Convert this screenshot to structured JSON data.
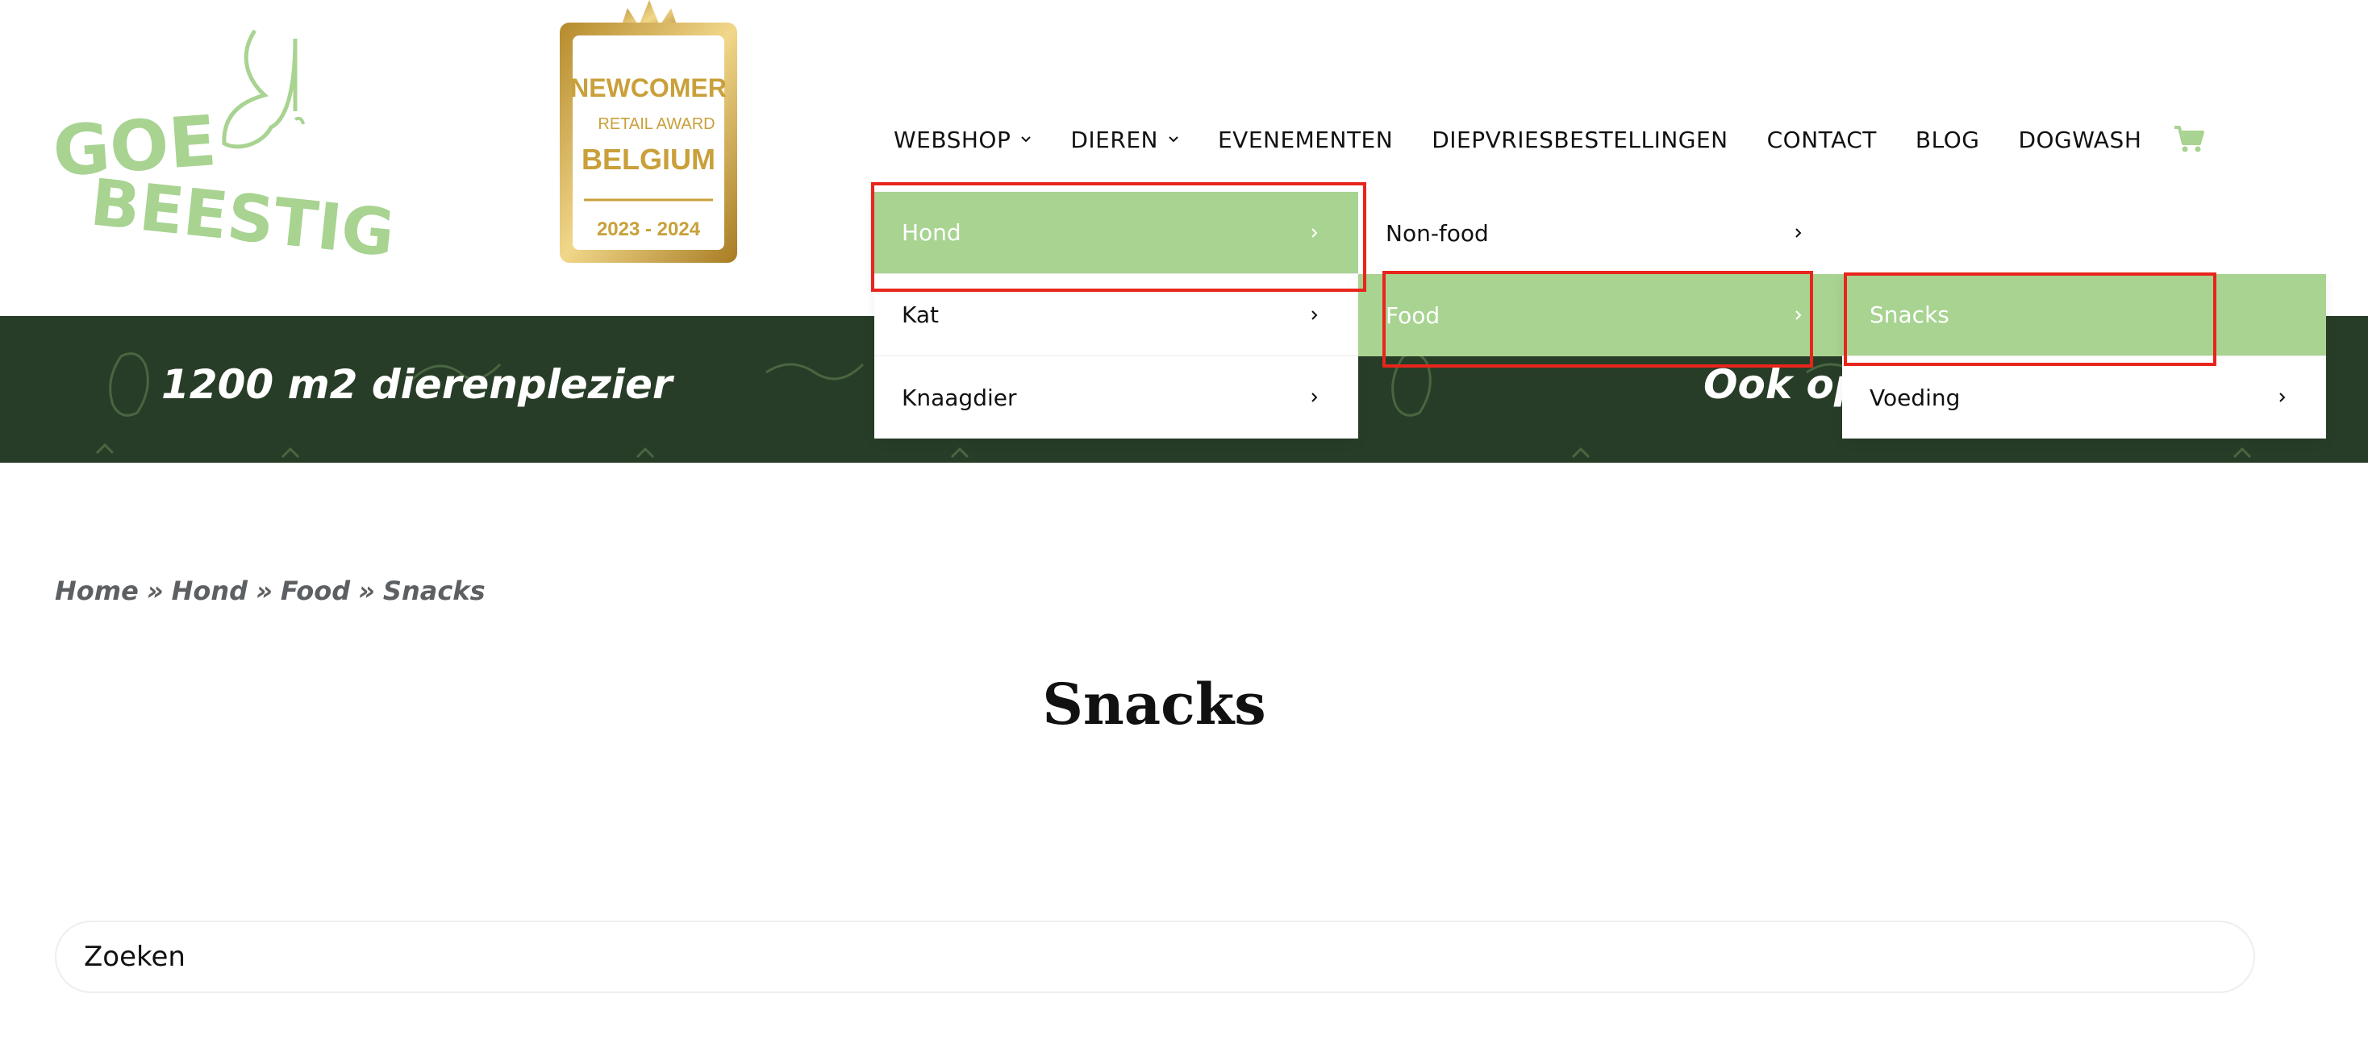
{
  "brand": {
    "logo_text_line1": "GOE",
    "logo_text_line2": "BEESTIG",
    "logo_color": "#a8d391"
  },
  "award": {
    "line1": "NEWCOMER",
    "line2": "RETAIL AWARD",
    "line3": "BELGIUM",
    "years": "2023 - 2024",
    "color": "#c9a03a"
  },
  "nav": {
    "items": [
      {
        "label": "WEBSHOP",
        "has_dropdown": true
      },
      {
        "label": "DIEREN",
        "has_dropdown": true
      },
      {
        "label": "EVENEMENTEN",
        "has_dropdown": false
      },
      {
        "label": "DIEPVRIESBESTELLINGEN",
        "has_dropdown": false
      },
      {
        "label": "CONTACT",
        "has_dropdown": false
      },
      {
        "label": "BLOG",
        "has_dropdown": false
      },
      {
        "label": "DOGWASH",
        "has_dropdown": false
      }
    ],
    "cart_icon": "cart-icon"
  },
  "banner": {
    "text_left": "1200 m2 dierenplezier",
    "text_right": "Ook op",
    "background": "#283d27"
  },
  "menu": {
    "level1": [
      {
        "label": "Hond",
        "active": true
      },
      {
        "label": "Kat",
        "active": false
      },
      {
        "label": "Knaagdier",
        "active": false
      }
    ],
    "level2": [
      {
        "label": "Non-food",
        "active": false
      },
      {
        "label": "Food",
        "active": true
      }
    ],
    "level3": [
      {
        "label": "Snacks",
        "active": true,
        "has_submenu": false
      },
      {
        "label": "Voeding",
        "active": false,
        "has_submenu": true
      }
    ],
    "active_color": "#a8d391",
    "highlight_color": "#e8251c"
  },
  "breadcrumb": {
    "items": [
      "Home",
      "Hond",
      "Food",
      "Snacks"
    ],
    "separator": "»"
  },
  "page": {
    "title": "Snacks"
  },
  "search": {
    "placeholder": "Zoeken"
  }
}
